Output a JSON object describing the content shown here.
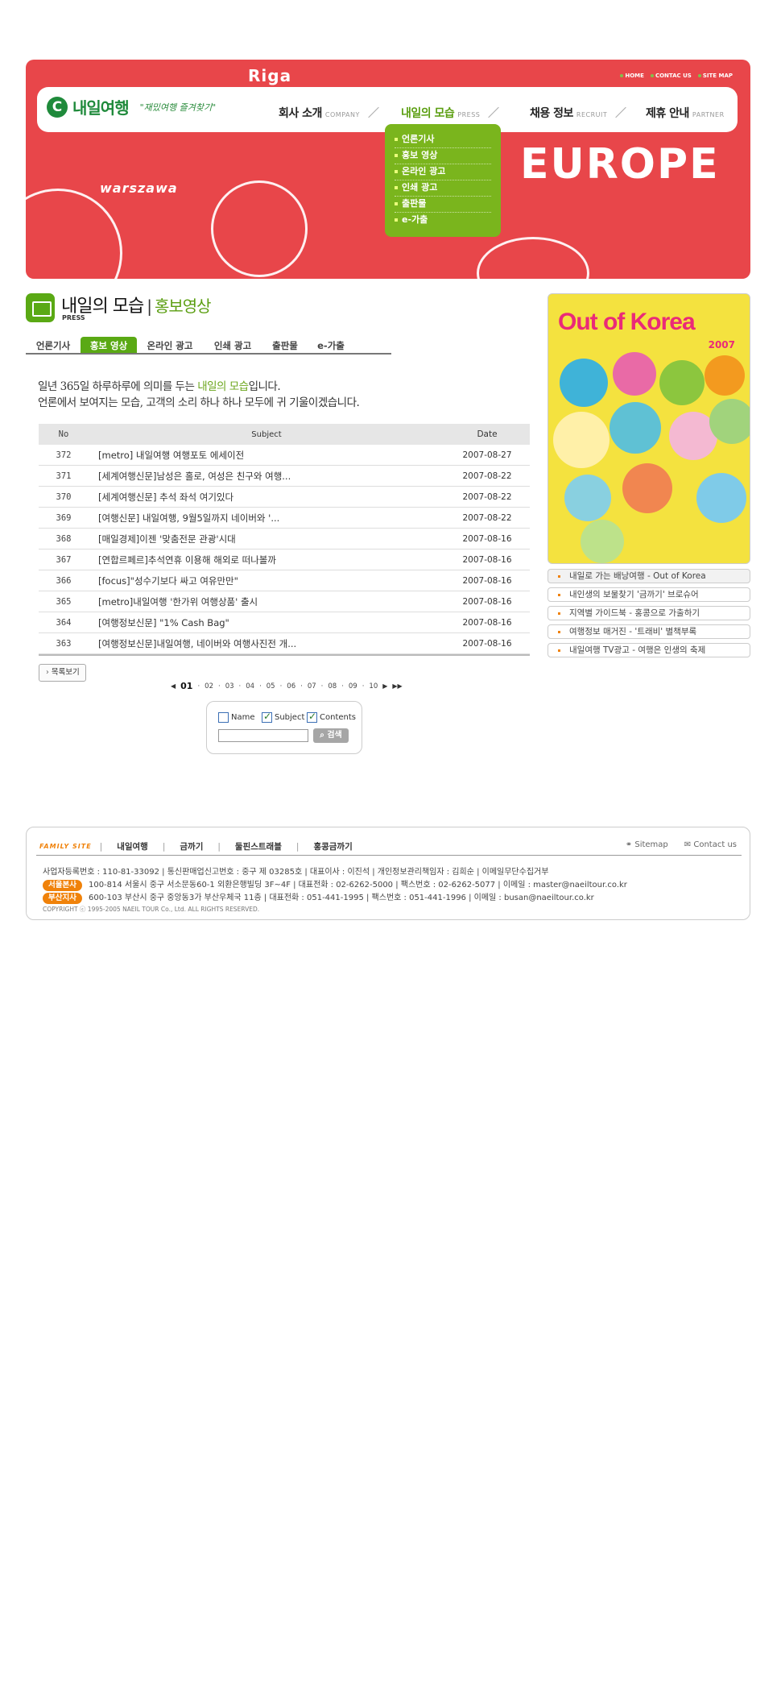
{
  "util_nav": [
    "HOME",
    "CONTAC US",
    "SITE MAP"
  ],
  "brand": {
    "mark": "C",
    "name": "내일여행",
    "slogan": "\"재밌여행 즐겨찾기\""
  },
  "banner_words": [
    "Riga",
    "EUROPE",
    "warszawa"
  ],
  "gnav": [
    {
      "ko": "회사 소개",
      "en": "COMPANY"
    },
    {
      "ko": "내일의 모습",
      "en": "PRESS"
    },
    {
      "ko": "채용 정보",
      "en": "RECRUIT"
    },
    {
      "ko": "제휴 안내",
      "en": "PARTNER"
    }
  ],
  "submenu": [
    "언론기사",
    "홍보 영상",
    "온라인 광고",
    "인쇄 광고",
    "출판물",
    "e-가출"
  ],
  "page": {
    "title": "내일의 모습",
    "sep": "|",
    "subtitle": "홍보영상",
    "en": "PRESS"
  },
  "tabs": [
    "언론기사",
    "홍보 영상",
    "온라인 광고",
    "인쇄 광고",
    "출판물",
    "e-가출"
  ],
  "intro": {
    "line1_pre": "일년 365일 하루하루에 의미를 두는 ",
    "line1_hl": "내일의 모습",
    "line1_post": "입니다.",
    "line2": "언론에서 보여지는 모습, 고객의 소리 하나 하나 모두에 귀 기울이겠습니다."
  },
  "table": {
    "headers": {
      "no": "No",
      "subject": "Subject",
      "date": "Date"
    },
    "rows": [
      {
        "no": "372",
        "subject": "[metro] 내일여행 여행포토 에세이전",
        "date": "2007-08-27"
      },
      {
        "no": "371",
        "subject": "[세계여행신문]남성은 홀로, 여성은 친구와 여행...",
        "date": "2007-08-22"
      },
      {
        "no": "370",
        "subject": "[세계여행신문] 추석 좌석 여기있다",
        "date": "2007-08-22"
      },
      {
        "no": "369",
        "subject": "[여행신문] 내일여행, 9월5일까지 네이버와 '...",
        "date": "2007-08-22"
      },
      {
        "no": "368",
        "subject": "[매일경제]이젠 '맞춤전문 관광'시대",
        "date": "2007-08-16"
      },
      {
        "no": "367",
        "subject": "[연합르페르]추석연휴 이용해 해외로 떠나볼까",
        "date": "2007-08-16"
      },
      {
        "no": "366",
        "subject": "[focus]\"성수기보다 싸고 여유만만\"",
        "date": "2007-08-16"
      },
      {
        "no": "365",
        "subject": "[metro]내일여행 '한가위 여행상품' 출시",
        "date": "2007-08-16"
      },
      {
        "no": "364",
        "subject": "[여행정보신문] \"1% Cash Bag\"",
        "date": "2007-08-16"
      },
      {
        "no": "363",
        "subject": "[여행정보신문]내일여행, 네이버와 여행사진전 개...",
        "date": "2007-08-16"
      }
    ]
  },
  "list_button": "목록보기",
  "pager": {
    "current": "01",
    "pages": [
      "02",
      "03",
      "04",
      "05",
      "06",
      "07",
      "08",
      "09",
      "10"
    ]
  },
  "search": {
    "opt_name": "Name",
    "opt_subject": "Subject",
    "opt_contents": "Contents",
    "button": "검색",
    "value": ""
  },
  "poster": {
    "title": "Out of Korea",
    "year": "2007"
  },
  "promo_links": [
    "내일로 가는 배낭여행 - Out of Korea",
    "내인생의 보물찾기 '금까기' 브로슈어",
    "지역별 가이드북 - 홍콩으로 가출하기",
    "여행정보 매거진 - '트래비' 별책부록",
    "내일여행 TV광고 - 여행은 인생의 축제"
  ],
  "footer": {
    "family_label": "FAMILY SITE",
    "family": [
      "내일여행",
      "금까기",
      "둘핀스트래블",
      "홍콩금까기"
    ],
    "sitemap": "Sitemap",
    "contact": "Contact us",
    "biz": "사업자등록번호 : 110-81-33092 | 통신판매업신고번호 : 중구 제 03285호 | 대표이사 : 이진석 | 개인정보관리책임자 : 김희순 | 이메일무단수집거부",
    "seoul_badge": "서울본사",
    "seoul": "100-814 서울시 중구 서소문동60-1 외환은행빌딩 3F~4F | 대표전화 : 02-6262-5000 | 팩스번호 : 02-6262-5077 | 이메일 : master@naeiltour.co.kr",
    "busan_badge": "부산지사",
    "busan": "600-103 부산시 중구 중앙동3가 부산우체국 11층 | 대표전화 : 051-441-1995 | 팩스번호 : 051-441-1996 | 이메일 : busan@naeiltour.co.kr",
    "copyright": "COPYRIGHT ⓒ 1995-2005 NAEIL TOUR Co., Ltd. ALL RIGHTS RESERVED."
  },
  "colors": {
    "accent_green": "#5aa914",
    "banner_red": "#e8464a",
    "footer_orange": "#f0820a"
  }
}
